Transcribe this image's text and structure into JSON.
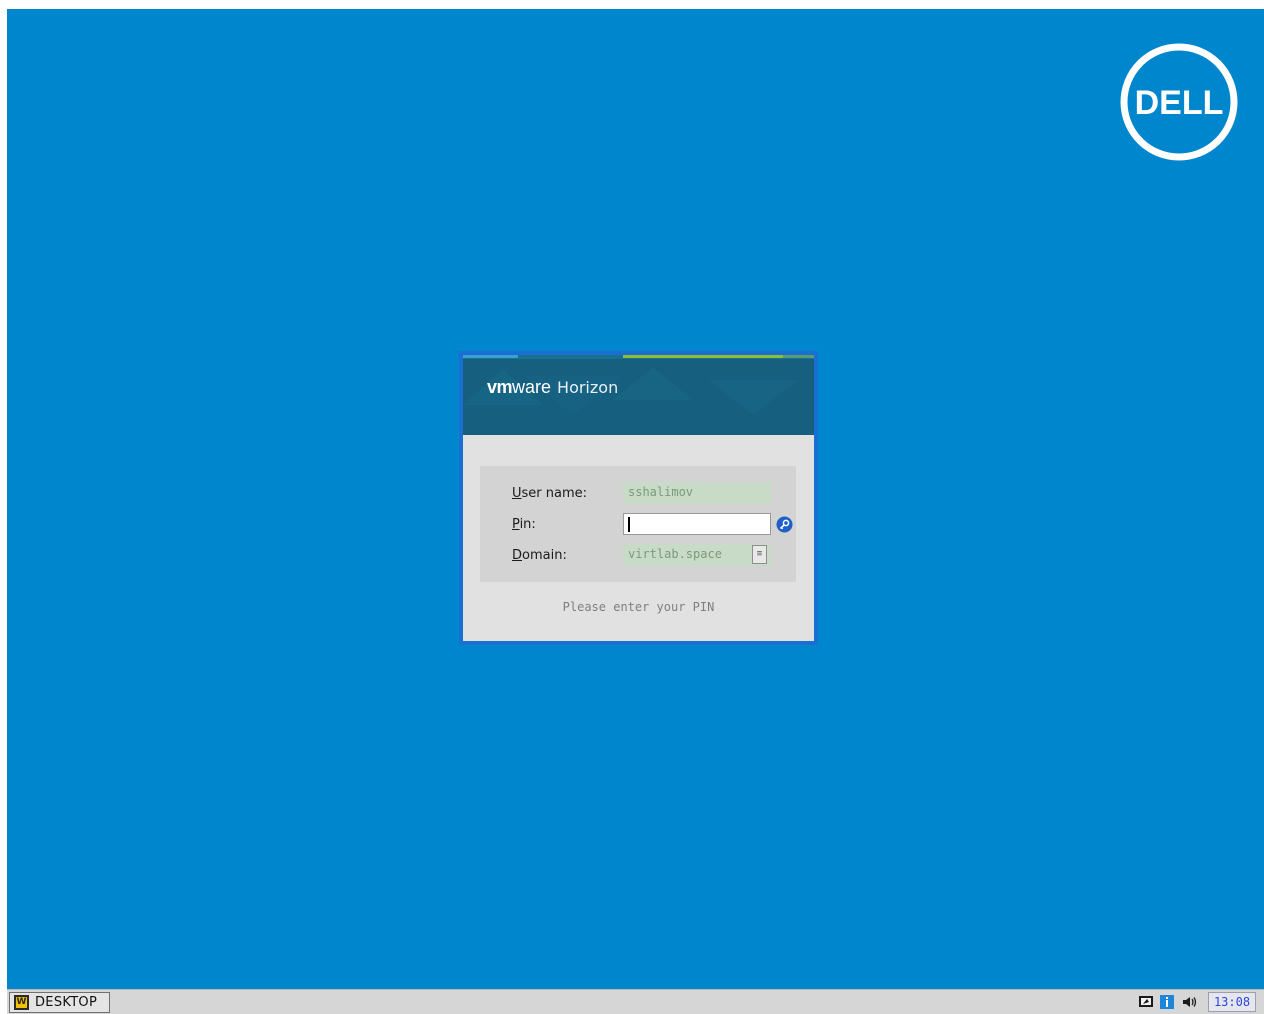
{
  "desktop": {
    "background_color": "#0086cc",
    "logo_text": "DELL"
  },
  "login_dialog": {
    "brand": {
      "vm": "vm",
      "ware": "ware",
      "product": "Horizon"
    },
    "fields": {
      "username": {
        "label_mnemonic": "U",
        "label_rest": "ser name:",
        "value": "sshalimov"
      },
      "pin": {
        "label_mnemonic": "P",
        "label_rest": "in:",
        "value": ""
      },
      "domain": {
        "label_mnemonic": "D",
        "label_rest": "omain:",
        "value": "virtlab.space"
      }
    },
    "status_message": "Please enter your PIN",
    "accent_color": "#1a6fd3"
  },
  "taskbar": {
    "start_icon_letter": "W",
    "start_label": "DESKTOP",
    "tray_icons": [
      "display-icon",
      "info-icon",
      "speaker-icon"
    ],
    "clock": "13:08"
  }
}
